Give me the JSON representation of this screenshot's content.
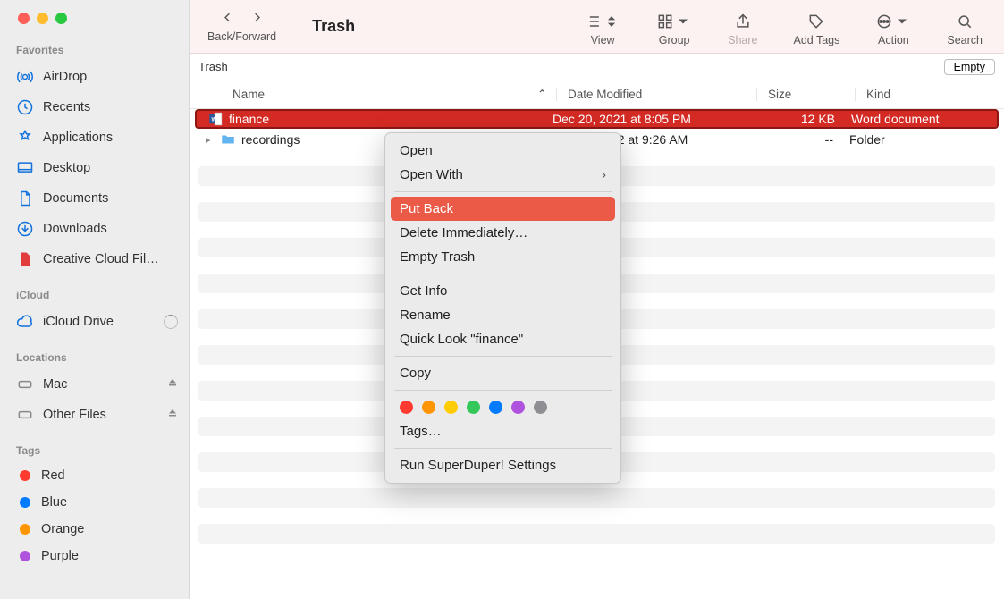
{
  "window": {
    "title": "Trash"
  },
  "toolbar": {
    "back_forward": "Back/Forward",
    "view": "View",
    "group": "Group",
    "share": "Share",
    "add_tags": "Add Tags",
    "action": "Action",
    "search": "Search"
  },
  "pathbar": {
    "location": "Trash",
    "empty_label": "Empty"
  },
  "sidebar": {
    "favorites_label": "Favorites",
    "favorites": [
      "AirDrop",
      "Recents",
      "Applications",
      "Desktop",
      "Documents",
      "Downloads",
      "Creative Cloud Fil…"
    ],
    "icloud_label": "iCloud",
    "icloud": [
      "iCloud Drive"
    ],
    "locations_label": "Locations",
    "locations": [
      "Mac",
      "Other Files"
    ],
    "tags_label": "Tags",
    "tags": [
      {
        "name": "Red",
        "color": "#ff3b30"
      },
      {
        "name": "Blue",
        "color": "#007aff"
      },
      {
        "name": "Orange",
        "color": "#ff9500"
      },
      {
        "name": "Purple",
        "color": "#af52de"
      }
    ]
  },
  "columns": {
    "name": "Name",
    "date": "Date Modified",
    "size": "Size",
    "kind": "Kind"
  },
  "rows": [
    {
      "name": "finance",
      "date": "Dec 20, 2021 at 8:05 PM",
      "size": "12 KB",
      "kind": "Word document",
      "selected": true,
      "icon": "word"
    },
    {
      "name": "recordings",
      "date": "Feb 15, 2022 at 9:26 AM",
      "size": "--",
      "kind": "Folder",
      "selected": false,
      "icon": "folder",
      "disclosure": true
    }
  ],
  "context_menu": {
    "open": "Open",
    "open_with": "Open With",
    "put_back": "Put Back",
    "delete_immediately": "Delete Immediately…",
    "empty_trash": "Empty Trash",
    "get_info": "Get Info",
    "rename": "Rename",
    "quick_look": "Quick Look \"finance\"",
    "copy": "Copy",
    "tags": "Tags…",
    "run_superduper": "Run SuperDuper! Settings",
    "tag_colors": [
      "#ff3b30",
      "#ff9500",
      "#ffcc00",
      "#34c759",
      "#007aff",
      "#af52de",
      "#8e8e93"
    ]
  }
}
